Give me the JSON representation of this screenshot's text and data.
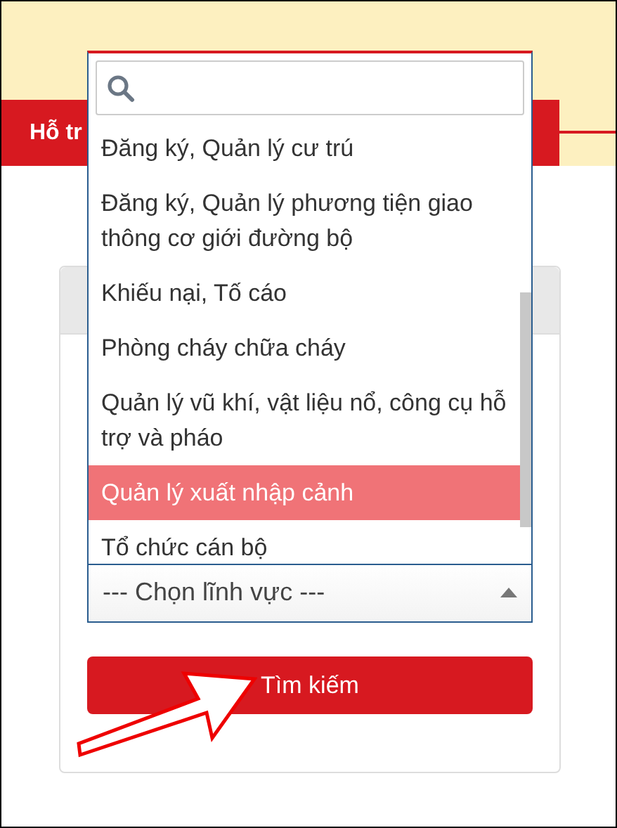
{
  "nav": {
    "label": "Hỗ tr"
  },
  "field_select": {
    "value": "--- Chọn lĩnh vực ---",
    "expanded": true
  },
  "options": [
    {
      "label": "Đăng ký, Quản lý cư trú",
      "selected": false
    },
    {
      "label": "Đăng ký, Quản lý phương tiện giao thông cơ giới đường bộ",
      "selected": false
    },
    {
      "label": "Khiếu nại, Tố cáo",
      "selected": false
    },
    {
      "label": "Phòng cháy chữa cháy",
      "selected": false
    },
    {
      "label": "Quản lý vũ khí, vật liệu nổ, công cụ hỗ trợ và pháo",
      "selected": false
    },
    {
      "label": "Quản lý xuất nhập cảnh",
      "selected": true
    },
    {
      "label": "Tổ chức cán bộ",
      "selected": false
    }
  ],
  "search_button": "Tìm kiếm"
}
